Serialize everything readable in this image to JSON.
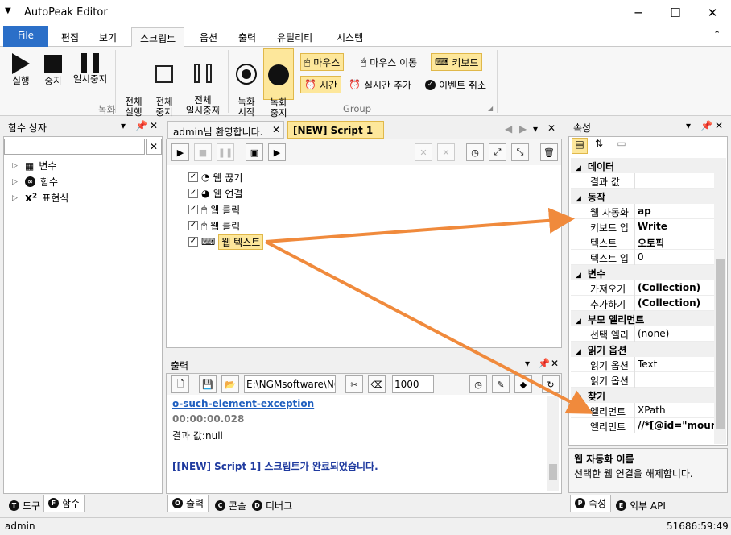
{
  "window": {
    "title": "AutoPeak Editor",
    "minimize": "─",
    "maximize": "☐",
    "close": "✕",
    "menu_glyph": "▼"
  },
  "ribbon_tabs": [
    "File",
    "편집",
    "보기",
    "스크립트",
    "옵션",
    "출력",
    "유틸리티",
    "시스템"
  ],
  "ribbon": {
    "run": "실행",
    "stop": "중지",
    "pause": "일시중지",
    "run_all": "전체\n실행",
    "stop_all": "전체\n중지",
    "pause_all": "전체\n일시중지",
    "record_group": "녹화",
    "rec_start": "녹화\n시작",
    "rec_stop": "녹화\n중지",
    "mouse": "마우스",
    "mouse_move": "마우스 이동",
    "keyboard": "키보드",
    "time": "시간",
    "realtime_add": "실시간 추가",
    "event_cancel": "이벤트 취소",
    "group_label": "Group",
    "collapse": "⌃"
  },
  "function_box": {
    "title": "함수 상자",
    "search_clear": "✕",
    "items": [
      "변수",
      "함수",
      "표현식"
    ],
    "tabs": [
      "도구",
      "함수"
    ]
  },
  "doc_tabs": [
    "admin님 환영합니다.",
    "[NEW] Script 1"
  ],
  "script_rows": [
    "웹 끊기",
    "웹 연결",
    "웹 클릭",
    "웹 클릭",
    "웹 텍스트"
  ],
  "output": {
    "title": "출력",
    "path": "E:\\NGMsoftware\\NG",
    "count": "1000",
    "lines": [
      "o-such-element-exception",
      "00:00:00.028",
      "결과 값:null",
      "[[NEW] Script 1] 스크립트가 완료되었습니다."
    ],
    "tabs": [
      "출력",
      "콘솔",
      "디버그"
    ]
  },
  "properties": {
    "title": "속성",
    "categories": {
      "data": "데이터",
      "action": "동작",
      "variable": "변수",
      "parent": "부모 엘리먼트",
      "read": "읽기 옵션",
      "find": "찾기"
    },
    "rows": {
      "result": {
        "k": "결과 값",
        "v": ""
      },
      "web_auto": {
        "k": "웹 자동화",
        "v": "ap"
      },
      "keyboard_in": {
        "k": "키보드 입",
        "v": "Write"
      },
      "text": {
        "k": "텍스트",
        "v": "오토픽"
      },
      "text_in": {
        "k": "텍스트 입",
        "v": "0"
      },
      "get": {
        "k": "가져오기",
        "v": "(Collection)"
      },
      "add": {
        "k": "추가하기",
        "v": "(Collection)"
      },
      "select_el": {
        "k": "선택 엘리",
        "v": "(none)"
      },
      "read_opt1": {
        "k": "읽기 옵션",
        "v": "Text"
      },
      "read_opt2": {
        "k": "읽기 옵션",
        "v": ""
      },
      "element1": {
        "k": "엘리먼트",
        "v": "XPath"
      },
      "element2": {
        "k": "엘리먼트",
        "v": "//*[@id=\"mount"
      }
    },
    "desc_title": "웹 자동화 이름",
    "desc_text": "선택한 웹 연결을 해제합니다.",
    "tabs": [
      "속성",
      "외부 API"
    ]
  },
  "status": {
    "user": "admin",
    "time": "51686:59:49"
  },
  "colors": {
    "accent": "#2b6fc8",
    "highlight": "#fde79b",
    "arrow": "#f08a3c",
    "link": "#1f5fbf"
  }
}
